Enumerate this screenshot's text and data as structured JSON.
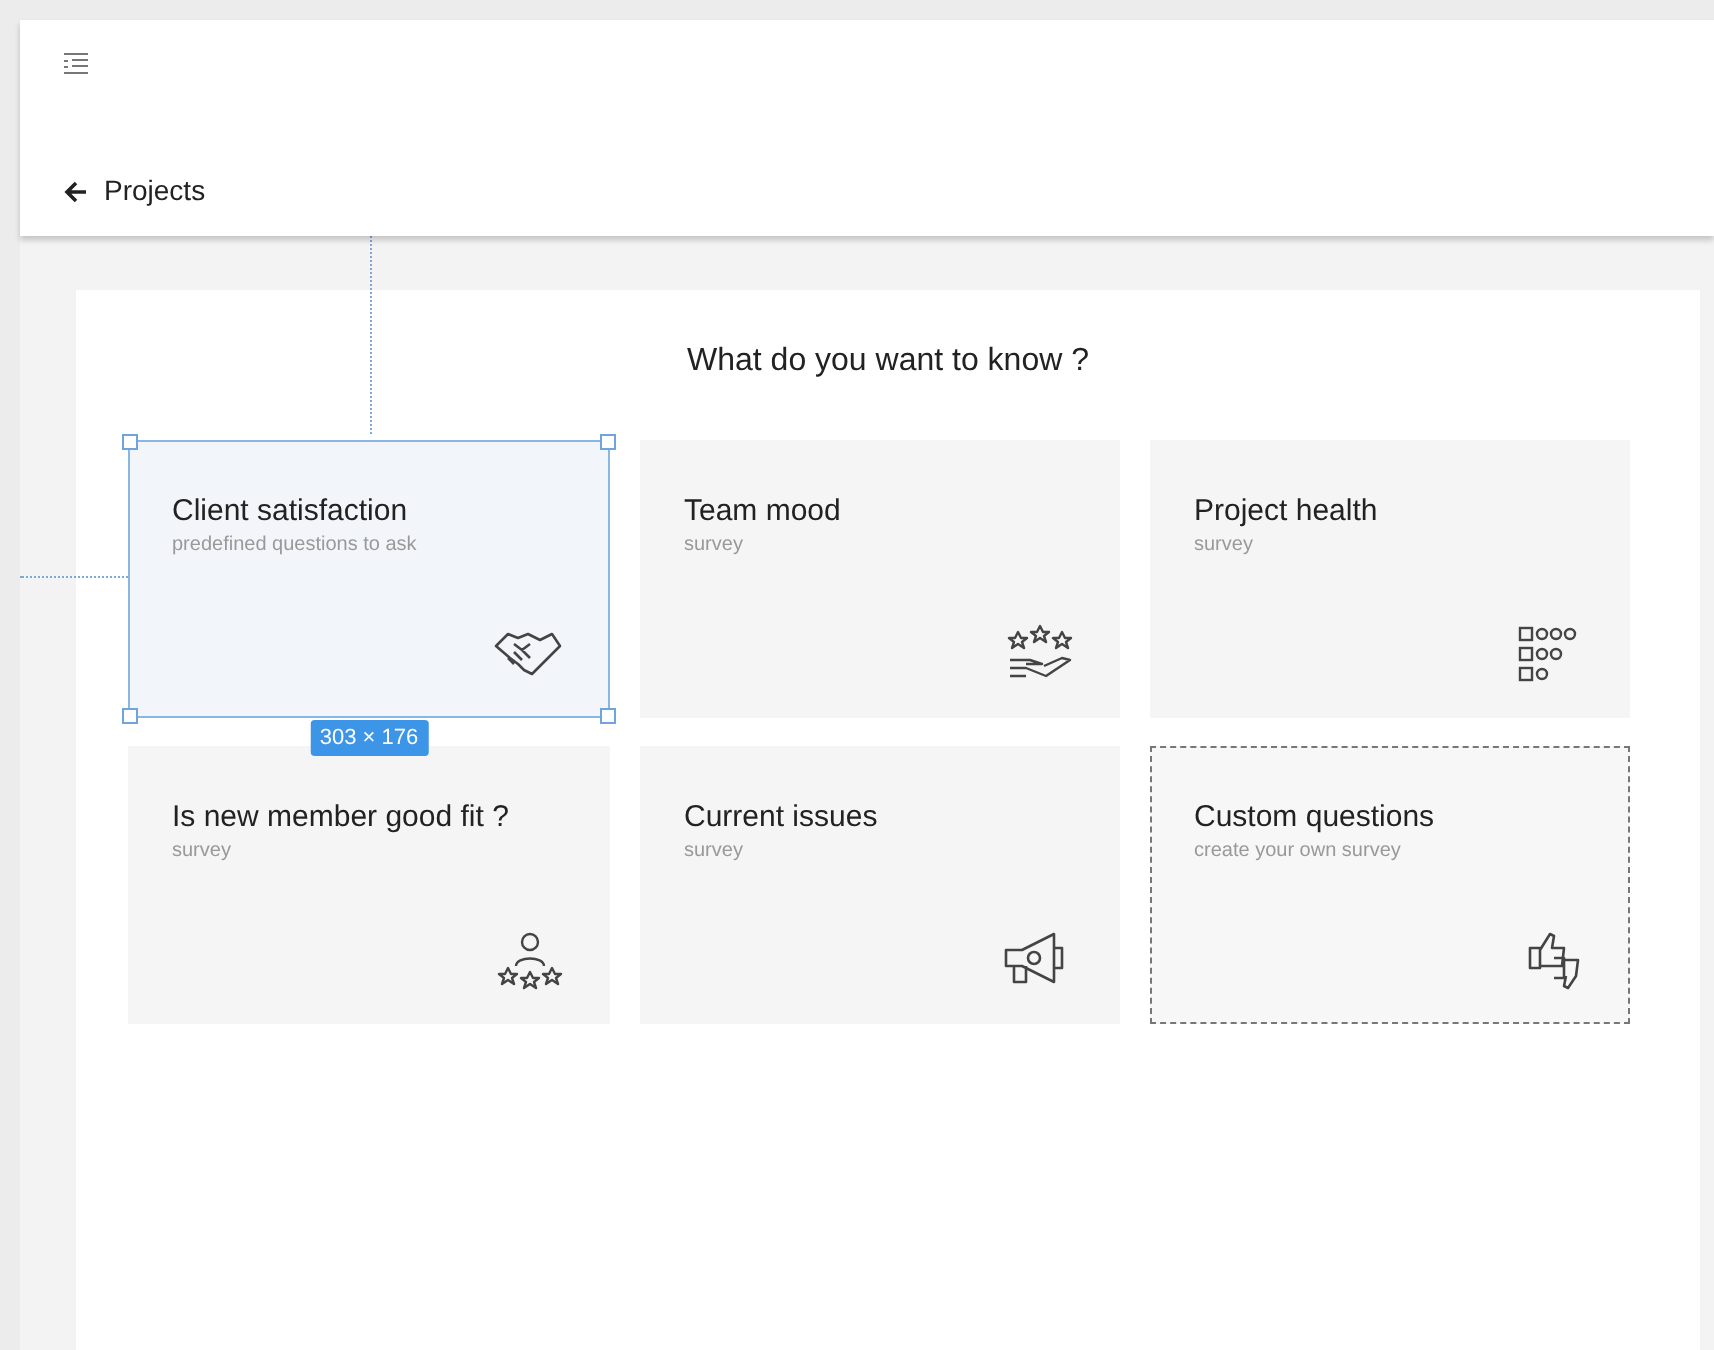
{
  "header": {
    "back_link": "Projects"
  },
  "heading": "What do you want to know ?",
  "cards": [
    {
      "title": "Client satisfaction",
      "subtitle": "predefined questions to ask",
      "kind": "template",
      "selected": true
    },
    {
      "title": "Team mood",
      "subtitle": "survey",
      "kind": "template",
      "selected": false
    },
    {
      "title": "Project health",
      "subtitle": "survey",
      "kind": "template",
      "selected": false
    },
    {
      "title": "Is new member good fit ?",
      "subtitle": "survey",
      "kind": "template",
      "selected": false
    },
    {
      "title": "Current issues",
      "subtitle": "survey",
      "kind": "template",
      "selected": false
    },
    {
      "title": "Custom questions",
      "subtitle": "create your own survey",
      "kind": "custom",
      "selected": false
    }
  ],
  "selection": {
    "size": "303 × 176"
  }
}
